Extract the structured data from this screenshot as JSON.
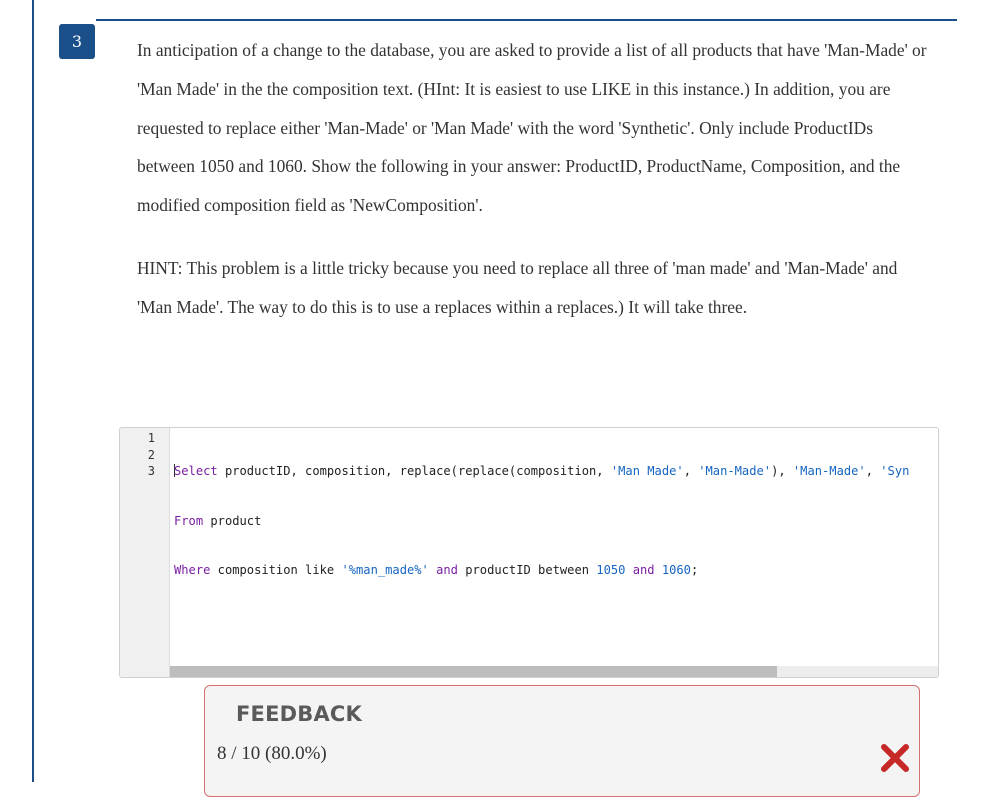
{
  "question": {
    "number": "3",
    "paragraph1": "In anticipation of a change to the database, you are asked to provide a list of all products that have 'Man-Made' or 'Man Made' in the the composition text. (HInt: It is easiest to use LIKE in this instance.)  In addition, you are requested to replace either 'Man-Made' or 'Man Made' with the word 'Synthetic'. Only include ProductIDs between 1050 and 1060.  Show the following in your answer: ProductID, ProductName, Composition, and the modified composition field as 'NewComposition'.",
    "paragraph2": "HINT:  This problem is a little tricky because you need to replace all three of 'man made' and  'Man-Made' and 'Man Made'.  The way to do this is to use a replaces within a replaces.) It will take three."
  },
  "editor": {
    "line_numbers": [
      "1",
      "2",
      "3"
    ],
    "lines": [
      {
        "kw1": "Select",
        "t1": " productID, composition, replace(replace(composition, ",
        "s1": "'Man Made'",
        "t2": ", ",
        "s2": "'Man-Made'",
        "t3": "), ",
        "s3": "'Man-Made'",
        "t4": ", ",
        "s4": "'Syn"
      },
      {
        "kw1": "From",
        "t1": " product"
      },
      {
        "kw1": "Where",
        "t1": " composition like ",
        "s1": "'%man_made%'",
        "t2": " ",
        "kw2": "and",
        "t3": " productID between ",
        "n1": "1050",
        "t4": " ",
        "kw3": "and",
        "t5": " ",
        "n2": "1060",
        "t6": ";"
      }
    ]
  },
  "feedback": {
    "title": "FEEDBACK",
    "score": "8 / 10  (80.0%)",
    "status_icon": "x-mark-icon",
    "status_color": "#c62828"
  },
  "colors": {
    "accent": "#1a4f8a",
    "keyword": "#7a1fa2",
    "string": "#1565c0",
    "feedback_border": "#d67070"
  }
}
